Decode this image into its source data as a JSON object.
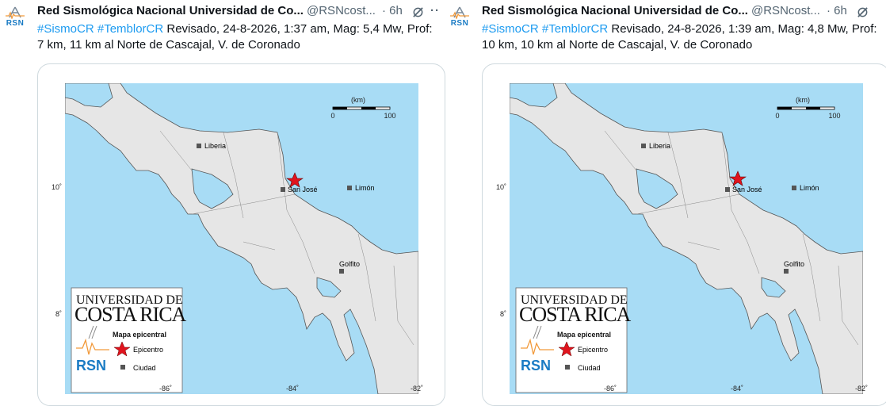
{
  "tweets": [
    {
      "author_name": "Red Sismológica Nacional Universidad de Co...",
      "handle": "@RSNcost...",
      "time": "· 6h",
      "avatar_text": "RSN",
      "hashtags": [
        "#SismoCR",
        "#TemblorCR"
      ],
      "line1_rest": " Revisado, 24-8-2026, 1:37 am, Mag: 5,4 Mw, Prof:",
      "line2": "7 km, 11 km al Norte de Cascajal, V. de Coronado",
      "map": {
        "scale_unit": "(km)",
        "scale_min": "0",
        "scale_max": "100",
        "cities": [
          "Liberia",
          "San José",
          "Limón",
          "Golfito"
        ],
        "lat_labels": [
          "10˚",
          "8˚"
        ],
        "lon_labels": [
          "-86˚",
          "-84˚",
          "-82˚"
        ],
        "logo_line1": "UNIVERSIDAD DE",
        "logo_line2": "COSTA RICA",
        "legend_title": "Mapa epicentral",
        "legend_epicentro": "Epicentro",
        "legend_ciudad": "Ciudad",
        "logo_rsn": "RSN"
      }
    },
    {
      "author_name": "Red Sismológica Nacional Universidad de Co...",
      "handle": "@RSNcost...",
      "time": "· 6h",
      "avatar_text": "RSN",
      "hashtags": [
        "#SismoCR",
        "#TemblorCR"
      ],
      "line1_rest": " Revisado, 24-8-2026, 1:39 am, Mag: 4,8 Mw, Prof:",
      "line2": "10 km, 10 km al Norte de Cascajal, V. de Coronado",
      "map": {
        "scale_unit": "(km)",
        "scale_min": "0",
        "scale_max": "100",
        "cities": [
          "Liberia",
          "San José",
          "Limón",
          "Golfito"
        ],
        "lat_labels": [
          "10˚",
          "8˚"
        ],
        "lon_labels": [
          "-86˚",
          "-84˚",
          "-82˚"
        ],
        "logo_line1": "UNIVERSIDAD DE",
        "logo_line2": "COSTA RICA",
        "legend_title": "Mapa epicentral",
        "legend_epicentro": "Epicentro",
        "legend_ciudad": "Ciudad",
        "logo_rsn": "RSN"
      }
    }
  ],
  "colors": {
    "hashtag": "#1d9bf0",
    "sea": "#a8dcf5",
    "land": "#e6e6e6",
    "epicenter": "#e0141e",
    "rsn_blue": "#1a7bc4"
  }
}
